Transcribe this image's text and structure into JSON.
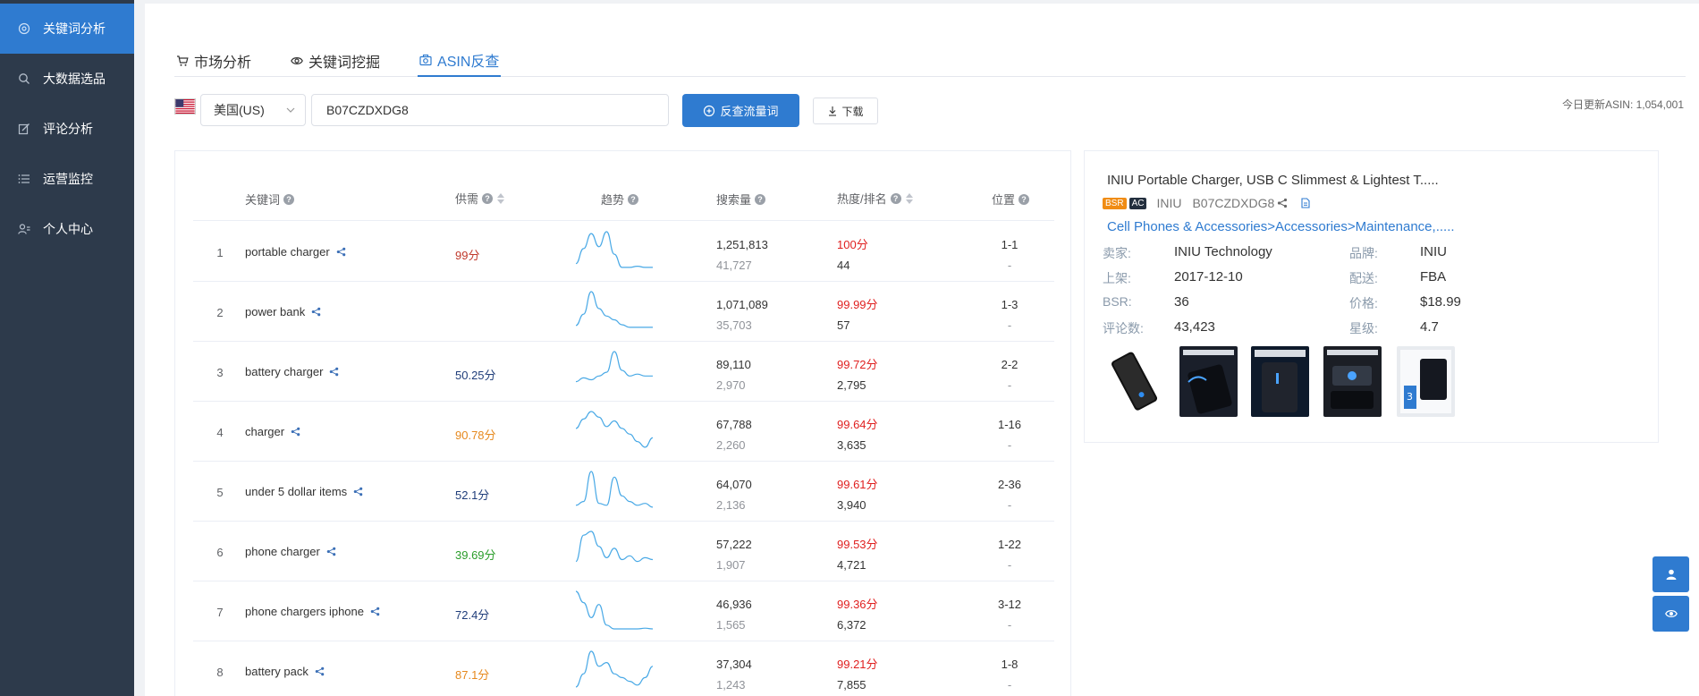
{
  "sidebar": {
    "items": [
      {
        "label": "关键词分析",
        "icon": "target-icon",
        "active": true
      },
      {
        "label": "大数据选品",
        "icon": "search-icon",
        "active": false
      },
      {
        "label": "评论分析",
        "icon": "edit-icon",
        "active": false
      },
      {
        "label": "运营监控",
        "icon": "list-icon",
        "active": false
      },
      {
        "label": "个人中心",
        "icon": "users-icon",
        "active": false
      }
    ]
  },
  "tabs": [
    {
      "label": "市场分析",
      "icon": "cart-icon"
    },
    {
      "label": "关键词挖掘",
      "icon": "eye-icon"
    },
    {
      "label": "ASIN反查",
      "icon": "camera-icon",
      "active": true
    }
  ],
  "search": {
    "country": "美国(US)",
    "flag": "us-flag-icon",
    "asin_value": "B07CZDXDG8",
    "query_button": "反查流量词",
    "download_button": "下载",
    "update_note": "今日更新ASIN: 1,054,001"
  },
  "table": {
    "headers": {
      "keyword": "关键词",
      "supply_demand": "供需",
      "trend": "趋势",
      "search_volume": "搜索量",
      "heat_rank": "热度/排名",
      "position": "位置"
    },
    "rows": [
      {
        "idx": "1",
        "keyword": "portable charger",
        "sd": "99分",
        "sd_color": "#c0392b",
        "vol": "1,251,813",
        "vol2": "41,727",
        "heat": "100分",
        "rank": "44",
        "pos": "1-1",
        "pos2": "-",
        "trend": [
          0.15,
          0.55,
          0.95,
          0.6,
          1.0,
          0.4,
          0.05,
          0.05,
          0.08,
          0.05,
          0.05
        ]
      },
      {
        "idx": "2",
        "keyword": "power bank",
        "sd": "",
        "sd_color": "#333333",
        "vol": "1,071,089",
        "vol2": "35,703",
        "heat": "99.99分",
        "rank": "57",
        "pos": "1-3",
        "pos2": "-",
        "trend": [
          0.1,
          0.4,
          1.0,
          0.55,
          0.35,
          0.25,
          0.12,
          0.05,
          0.05,
          0.05,
          0.05
        ]
      },
      {
        "idx": "3",
        "keyword": "battery charger",
        "sd": "50.25分",
        "sd_color": "#1f3d7a",
        "vol": "89,110",
        "vol2": "2,970",
        "heat": "99.72分",
        "rank": "2,795",
        "pos": "2-2",
        "pos2": "-",
        "trend": [
          0.2,
          0.3,
          0.25,
          0.35,
          0.45,
          1.0,
          0.5,
          0.35,
          0.4,
          0.35,
          0.35
        ]
      },
      {
        "idx": "4",
        "keyword": "charger",
        "sd": "90.78分",
        "sd_color": "#e6891e",
        "vol": "67,788",
        "vol2": "2,260",
        "heat": "99.64分",
        "rank": "3,635",
        "pos": "1-16",
        "pos2": "-",
        "trend": [
          0.55,
          0.8,
          1.0,
          0.85,
          0.6,
          0.75,
          0.55,
          0.4,
          0.2,
          0.05,
          0.3
        ]
      },
      {
        "idx": "5",
        "keyword": "under 5 dollar items",
        "sd": "52.1分",
        "sd_color": "#1f3d7a",
        "vol": "64,070",
        "vol2": "2,136",
        "heat": "99.61分",
        "rank": "3,940",
        "pos": "2-36",
        "pos2": "-",
        "trend": [
          0.1,
          0.2,
          1.0,
          0.15,
          0.1,
          0.85,
          0.35,
          0.2,
          0.1,
          0.15,
          0.05
        ]
      },
      {
        "idx": "6",
        "keyword": "phone charger",
        "sd": "39.69分",
        "sd_color": "#2a9d2a",
        "vol": "57,222",
        "vol2": "1,907",
        "heat": "99.53分",
        "rank": "4,721",
        "pos": "1-22",
        "pos2": "-",
        "trend": [
          0.2,
          0.9,
          1.0,
          0.6,
          0.3,
          0.55,
          0.25,
          0.35,
          0.2,
          0.3,
          0.25
        ]
      },
      {
        "idx": "7",
        "keyword": "phone chargers iphone",
        "sd": "72.4分",
        "sd_color": "#1f3d7a",
        "vol": "46,936",
        "vol2": "1,565",
        "heat": "99.36分",
        "rank": "6,372",
        "pos": "3-12",
        "pos2": "-",
        "trend": [
          1.0,
          0.7,
          0.3,
          0.65,
          0.1,
          0.0,
          0.0,
          0.0,
          0.0,
          0.02,
          0.0
        ]
      },
      {
        "idx": "8",
        "keyword": "battery pack",
        "sd": "87.1分",
        "sd_color": "#e6891e",
        "vol": "37,304",
        "vol2": "1,243",
        "heat": "99.21分",
        "rank": "7,855",
        "pos": "1-8",
        "pos2": "-",
        "trend": [
          0.05,
          0.4,
          1.0,
          0.6,
          0.7,
          0.4,
          0.3,
          0.2,
          0.1,
          0.3,
          0.6
        ]
      }
    ]
  },
  "product": {
    "title": "INIU Portable Charger, USB C Slimmest & Lightest T.....",
    "badge_bsr": "BSR",
    "badge_ac": "AC",
    "brand_short": "INIU",
    "asin": "B07CZDXDG8",
    "category": "Cell Phones & Accessories>Accessories>Maintenance,.....",
    "seller_label": "卖家:",
    "seller": "INIU Technology",
    "brand_label": "品牌:",
    "brand": "INIU",
    "listed_label": "上架:",
    "listed": "2017-12-10",
    "shipping_label": "配送:",
    "shipping": "FBA",
    "bsr_label": "BSR:",
    "bsr": "36",
    "price_label": "价格:",
    "price": "$18.99",
    "reviews_label": "评论数:",
    "reviews": "43,423",
    "rating_label": "星级:",
    "rating": "4.7"
  },
  "floating": [
    {
      "icon": "user-icon"
    },
    {
      "icon": "eye-icon"
    }
  ],
  "colors": {
    "sidebar_bg": "#2d3a4b",
    "accent": "#2f7bd0",
    "heat_red": "#e02020",
    "trend_line": "#49a9e6"
  }
}
